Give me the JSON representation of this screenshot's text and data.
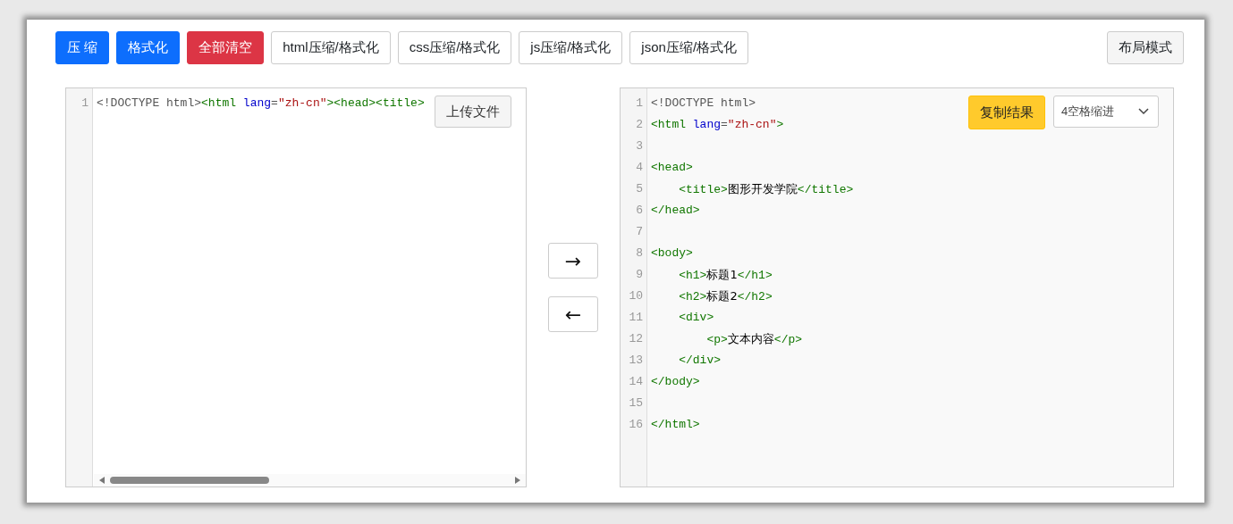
{
  "toolbar": {
    "buttons": [
      {
        "label": "压 缩",
        "kind": "primary"
      },
      {
        "label": "格式化",
        "kind": "primary"
      },
      {
        "label": "全部清空",
        "kind": "danger"
      },
      {
        "label": "html压缩/格式化",
        "kind": "outline"
      },
      {
        "label": "css压缩/格式化",
        "kind": "outline"
      },
      {
        "label": "js压缩/格式化",
        "kind": "outline"
      },
      {
        "label": "json压缩/格式化",
        "kind": "outline"
      }
    ],
    "layout_button": "布局模式"
  },
  "input_editor": {
    "upload_button": "上传文件",
    "lines": [
      {
        "number": "1",
        "tokens": [
          {
            "kind": "meta",
            "text": "<!DOCTYPE html>"
          },
          {
            "kind": "tag",
            "text": "<html "
          },
          {
            "kind": "attr",
            "text": "lang"
          },
          {
            "kind": "meta",
            "text": "="
          },
          {
            "kind": "string",
            "text": "\"zh-cn\""
          },
          {
            "kind": "tag",
            "text": ">"
          },
          {
            "kind": "tag",
            "text": "<head>"
          },
          {
            "kind": "tag",
            "text": "<title>"
          }
        ]
      }
    ]
  },
  "arrows": [
    "→",
    "←"
  ],
  "output_editor": {
    "copy_button": "复制结果",
    "indent_select": {
      "value": "4空格缩进"
    },
    "lines": [
      {
        "number": "1",
        "tokens": [
          {
            "kind": "meta",
            "text": "<!DOCTYPE html>"
          }
        ]
      },
      {
        "number": "2",
        "tokens": [
          {
            "kind": "tag",
            "text": "<html "
          },
          {
            "kind": "attr",
            "text": "lang"
          },
          {
            "kind": "meta",
            "text": "="
          },
          {
            "kind": "string",
            "text": "\"zh-cn\""
          },
          {
            "kind": "tag",
            "text": ">"
          }
        ]
      },
      {
        "number": "3"
      },
      {
        "number": "4",
        "tokens": [
          {
            "kind": "tag",
            "text": "<head>"
          }
        ]
      },
      {
        "number": "5",
        "tokens": [
          {
            "kind": "tag",
            "text": "    <title>"
          },
          {
            "kind": "text",
            "text": "图形开发学院"
          },
          {
            "kind": "tag",
            "text": "</title>"
          }
        ]
      },
      {
        "number": "6",
        "tokens": [
          {
            "kind": "tag",
            "text": "</head>"
          }
        ]
      },
      {
        "number": "7"
      },
      {
        "number": "8",
        "tokens": [
          {
            "kind": "tag",
            "text": "<body>"
          }
        ]
      },
      {
        "number": "9",
        "tokens": [
          {
            "kind": "tag",
            "text": "    <h1>"
          },
          {
            "kind": "text",
            "text": "标题1"
          },
          {
            "kind": "tag",
            "text": "</h1>"
          }
        ]
      },
      {
        "number": "10",
        "tokens": [
          {
            "kind": "tag",
            "text": "    <h2>"
          },
          {
            "kind": "text",
            "text": "标题2"
          },
          {
            "kind": "tag",
            "text": "</h2>"
          }
        ]
      },
      {
        "number": "11",
        "tokens": [
          {
            "kind": "tag",
            "text": "    <div>"
          }
        ]
      },
      {
        "number": "12",
        "tokens": [
          {
            "kind": "tag",
            "text": "        <p>"
          },
          {
            "kind": "text",
            "text": "文本内容"
          },
          {
            "kind": "tag",
            "text": "</p>"
          }
        ]
      },
      {
        "number": "13",
        "tokens": [
          {
            "kind": "tag",
            "text": "    </div>"
          }
        ]
      },
      {
        "number": "14",
        "tokens": [
          {
            "kind": "tag",
            "text": "</body>"
          }
        ]
      },
      {
        "number": "15"
      },
      {
        "number": "16",
        "tokens": [
          {
            "kind": "tag",
            "text": "</html>"
          }
        ]
      }
    ]
  }
}
